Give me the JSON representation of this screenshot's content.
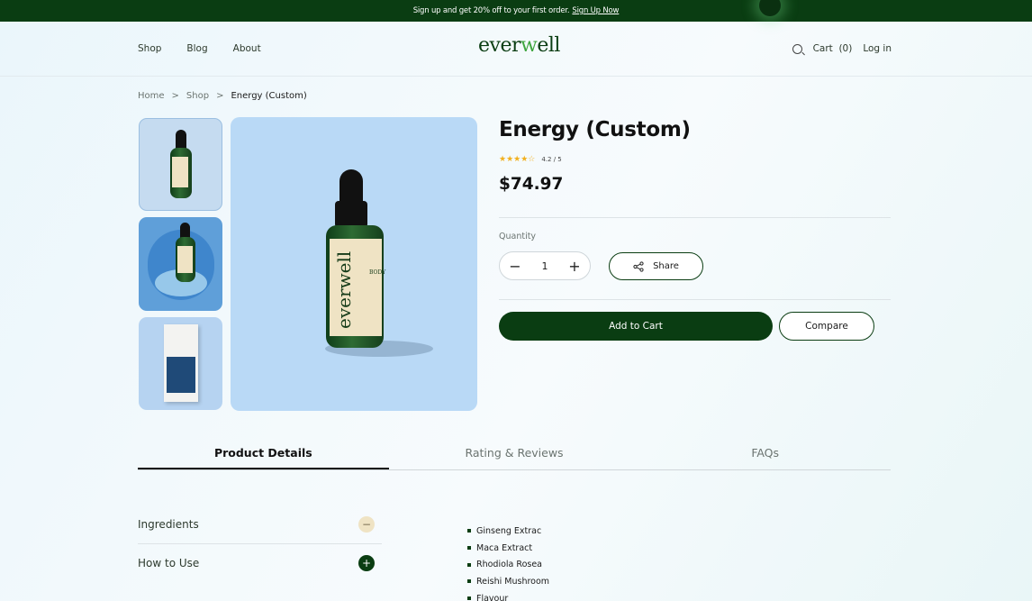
{
  "promo": {
    "text": "Sign up and get 20% off to your first order.",
    "link": "Sign Up Now"
  },
  "nav": {
    "items": [
      "Shop",
      "Blog",
      "About"
    ]
  },
  "logo": {
    "part1": "ever",
    "part2": "w",
    "part3": "ell"
  },
  "header_right": {
    "cart_label": "Cart",
    "cart_count": "(0)",
    "login": "Log in"
  },
  "breadcrumb": {
    "home": "Home",
    "shop": "Shop",
    "current": "Energy (Custom)",
    "sep": ">"
  },
  "product": {
    "title": "Energy (Custom)",
    "rating_text": "4.2 / 5",
    "stars": "★★★★☆",
    "price": "$74.97",
    "quantity_label": "Quantity",
    "quantity_value": "1",
    "minus": "−",
    "plus": "+",
    "share_label": "Share",
    "add_to_cart": "Add to Cart",
    "compare": "Compare",
    "bottle_brand": "everwell",
    "bottle_tag": "BODY"
  },
  "tabs": [
    "Product Details",
    "Rating & Reviews",
    "FAQs"
  ],
  "accordion": {
    "items": [
      {
        "label": "Ingredients",
        "icon": "−"
      },
      {
        "label": "How to Use",
        "icon": "+"
      }
    ]
  },
  "ingredients": [
    "Ginseng Extrac",
    "Maca Extract",
    "Rhodiola Rosea",
    "Reishi Mushroom",
    "Flavour"
  ],
  "colors": {
    "brand": "#0a3d12",
    "accent": "#3fa63f",
    "star": "#f2b01e",
    "beige": "#efe3c4"
  }
}
